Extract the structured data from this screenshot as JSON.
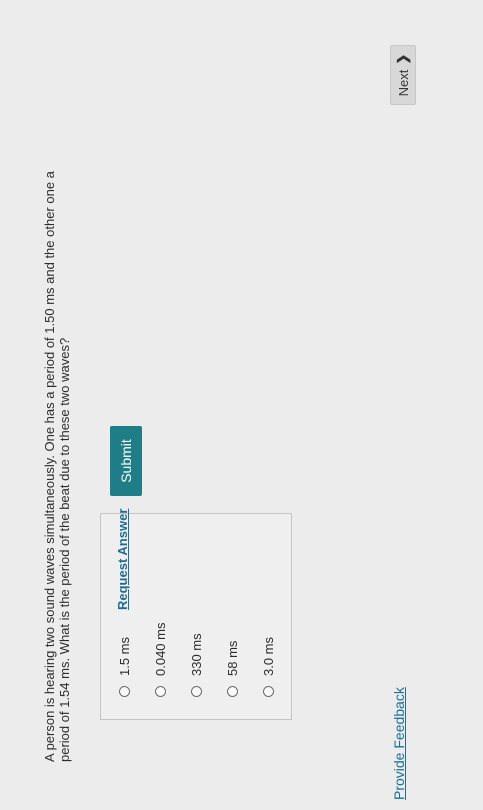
{
  "question": {
    "text": "A person is hearing two sound waves simultaneously. One has a period of 1.50 ms and the other one a period of 1.54 ms. What is the period of the beat due to these two waves?"
  },
  "choices": [
    {
      "label": "1.5 ms"
    },
    {
      "label": "0.040 ms"
    },
    {
      "label": "330 ms"
    },
    {
      "label": "58 ms"
    },
    {
      "label": "3.0 ms"
    }
  ],
  "actions": {
    "submit_label": "Submit",
    "request_answer_label": "Request Answer"
  },
  "footer": {
    "feedback_label": "Provide Feedback",
    "next_label": "Next"
  }
}
